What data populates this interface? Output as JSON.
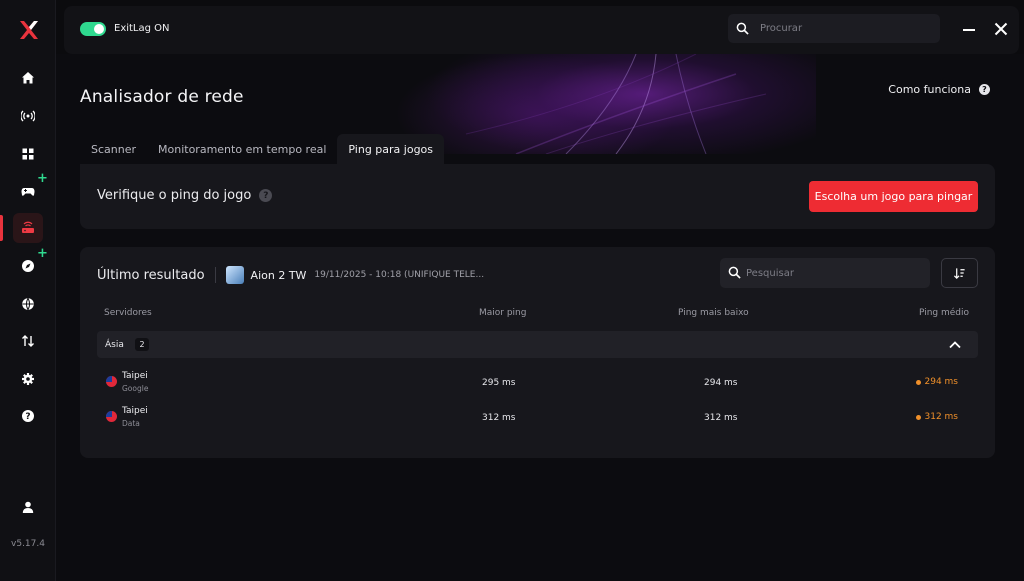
{
  "app": {
    "status_label": "ExitLag ON",
    "version": "v5.17.4",
    "search_placeholder": "Procurar"
  },
  "sidebar": {
    "items": [
      {
        "id": "home",
        "icon": "home-icon"
      },
      {
        "id": "network",
        "icon": "broadcast-icon"
      },
      {
        "id": "apps",
        "icon": "grid-icon"
      },
      {
        "id": "games",
        "icon": "gamepad-icon",
        "badge": "+"
      },
      {
        "id": "router",
        "icon": "router-icon",
        "active": true
      },
      {
        "id": "boost",
        "icon": "compass-icon",
        "badge": "+"
      },
      {
        "id": "web",
        "icon": "globe-icon"
      },
      {
        "id": "transfer",
        "icon": "arrows-icon"
      },
      {
        "id": "settings",
        "icon": "gear-icon"
      },
      {
        "id": "help",
        "icon": "help-icon"
      }
    ],
    "account_icon": "user-icon"
  },
  "page": {
    "title": "Analisador de rede",
    "how_it_works": "Como funciona",
    "tabs": [
      {
        "label": "Scanner"
      },
      {
        "label": "Monitoramento em tempo real"
      },
      {
        "label": "Ping para jogos",
        "active": true
      }
    ]
  },
  "ping_card": {
    "title": "Verifique o ping do jogo",
    "cta": "Escolha um jogo para pingar",
    "accent": "#ee2c33"
  },
  "results": {
    "title": "Último resultado",
    "game_name": "Aion 2 TW",
    "game_meta": "19/11/2025 - 10:18 (UNIFIQUE TELE...",
    "search_placeholder": "Pesquisar",
    "columns": {
      "servers": "Servidores",
      "max_ping": "Maior ping",
      "min_ping": "Ping mais baixo",
      "avg_ping": "Ping médio"
    },
    "group": {
      "name": "Ásia",
      "count": "2"
    },
    "rows": [
      {
        "name": "Taipei",
        "provider": "Google",
        "max": "295 ms",
        "min": "294 ms",
        "avg": "294 ms"
      },
      {
        "name": "Taipei",
        "provider": "Data",
        "max": "312 ms",
        "min": "312 ms",
        "avg": "312 ms"
      }
    ],
    "avg_color": "#f0902a"
  }
}
